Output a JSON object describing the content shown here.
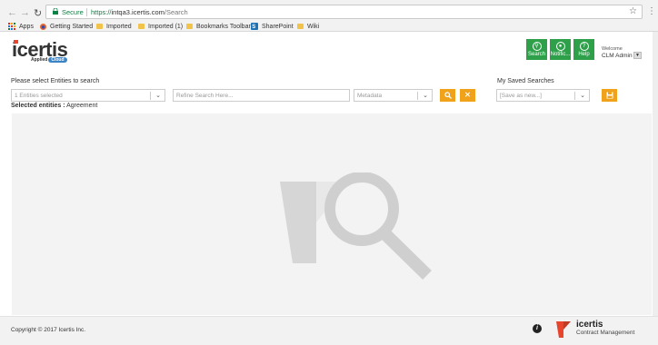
{
  "browser": {
    "secure_label": "Secure",
    "url_scheme": "https://",
    "url_host": "intqa3.icertis.com",
    "url_path": "/Search",
    "bookmarks": [
      {
        "label": "Apps",
        "icon": "apps-grid-icon"
      },
      {
        "label": "Getting Started",
        "icon": "firefox-icon"
      },
      {
        "label": "Imported",
        "icon": "folder-icon"
      },
      {
        "label": "Imported (1)",
        "icon": "folder-icon"
      },
      {
        "label": "Bookmarks Toolbar",
        "icon": "folder-icon"
      },
      {
        "label": "SharePoint",
        "icon": "sharepoint-icon"
      },
      {
        "label": "Wiki",
        "icon": "folder-icon"
      }
    ]
  },
  "header": {
    "logo_text": "icertis",
    "logo_sub": "Applied",
    "logo_cloud": "Cloud",
    "buttons": [
      {
        "label": "Search",
        "icon": "search-icon"
      },
      {
        "label": "Notific...",
        "icon": "bell-icon"
      },
      {
        "label": "Help",
        "icon": "question-icon"
      }
    ],
    "welcome": "Welcome",
    "user": "CLM Admin"
  },
  "search": {
    "entities_label": "Please select Entities to search",
    "entities_value": "1 Entities selected",
    "refine_placeholder": "Refine Search Here...",
    "metadata_value": "Metadata",
    "selected_label": "Selected entities :",
    "selected_value": "Agreement",
    "saved_label": "My Saved Searches",
    "saved_value": "[Save as new...]"
  },
  "footer": {
    "copyright": "Copyright © 2017 Icertis Inc.",
    "brand": "icertis",
    "brand_sub": "Contract Management",
    "info_glyph": "i"
  },
  "colors": {
    "green": "#2fa04a",
    "orange": "#f0a21a",
    "red": "#e8452c",
    "cloud_blue": "#3a84c6"
  }
}
